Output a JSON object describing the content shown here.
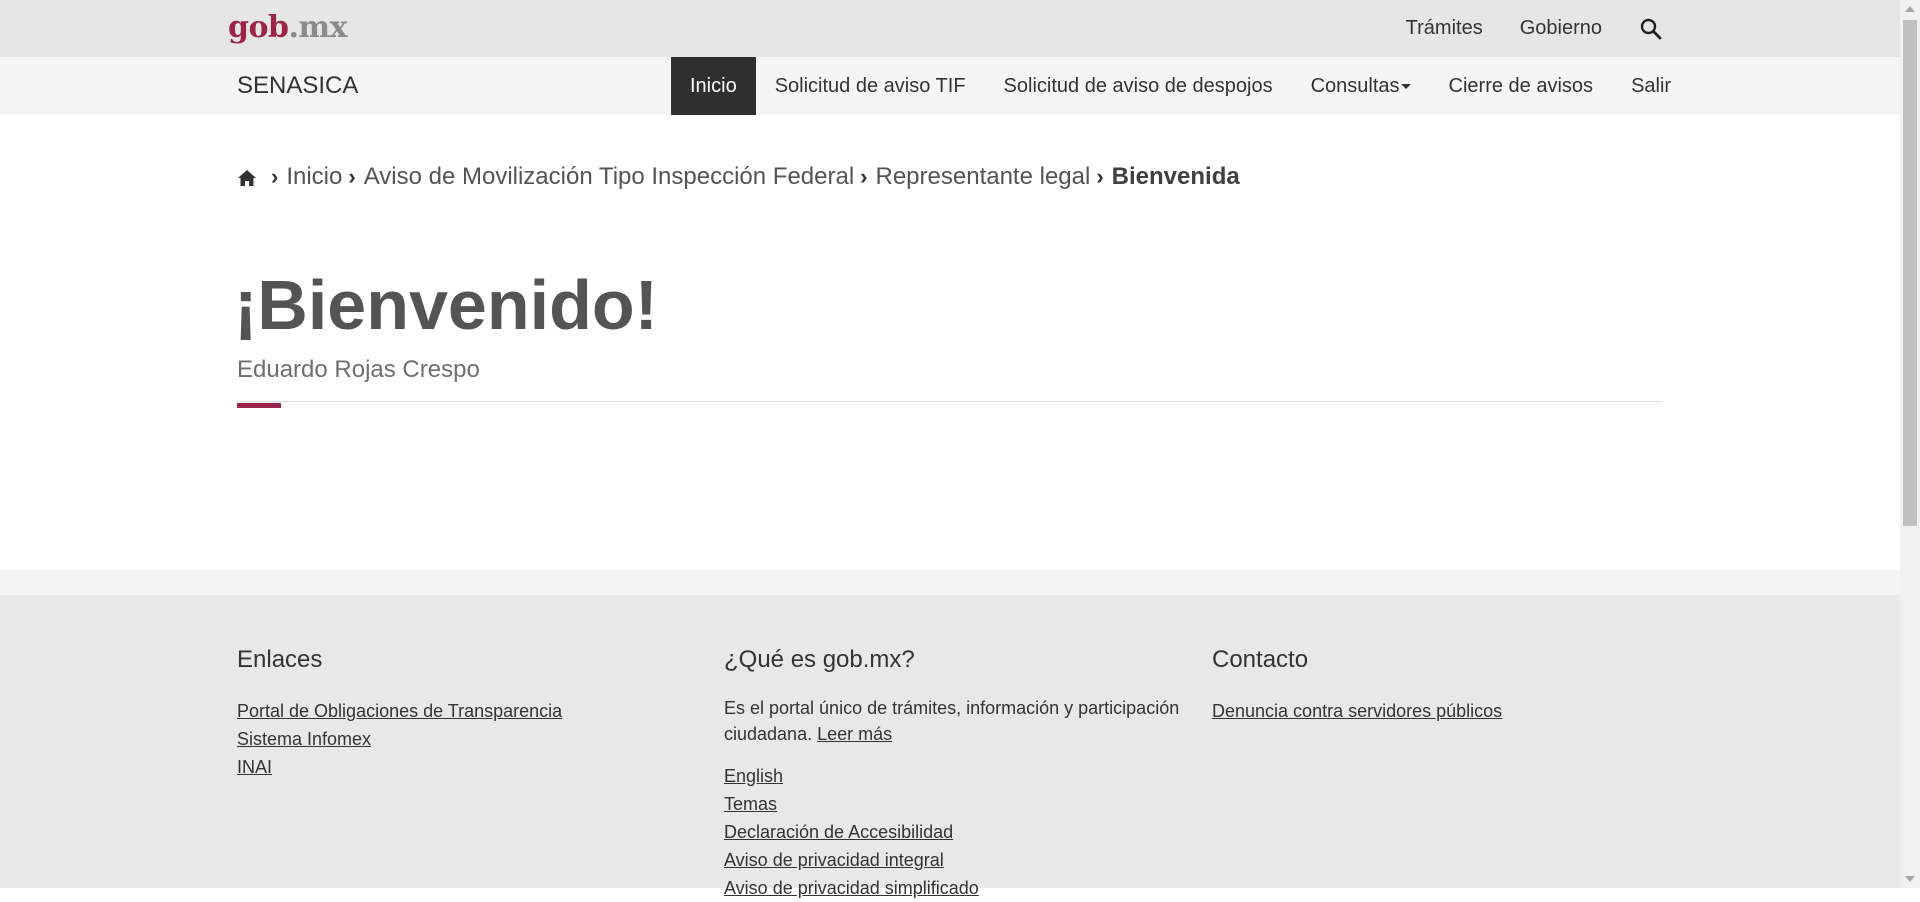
{
  "gov_header": {
    "logo_gob": "gob",
    "logo_mx": ".mx",
    "links": [
      "Trámites",
      "Gobierno"
    ],
    "search_icon": "search-icon"
  },
  "app_header": {
    "brand": "SENASICA",
    "nav": [
      {
        "label": "Inicio",
        "active": true
      },
      {
        "label": "Solicitud de aviso TIF"
      },
      {
        "label": "Solicitud de aviso de despojos"
      },
      {
        "label": "Consultas",
        "dropdown": true
      },
      {
        "label": "Cierre de avisos"
      },
      {
        "label": "Salir"
      }
    ]
  },
  "breadcrumb": {
    "home_icon": "home-icon",
    "items": [
      "Inicio",
      "Aviso de Movilización Tipo Inspección Federal",
      "Representante legal"
    ],
    "current": "Bienvenida"
  },
  "main": {
    "title": "¡Bienvenido!",
    "user_name": "Eduardo Rojas Crespo"
  },
  "footer": {
    "enlaces": {
      "title": "Enlaces",
      "links": [
        "Portal de Obligaciones de Transparencia",
        "Sistema Infomex",
        "INAI"
      ]
    },
    "que_es": {
      "title": "¿Qué es gob.mx?",
      "description": "Es el portal único de trámites, información y participación ciudadana.",
      "read_more": "Leer más",
      "links": [
        "English",
        "Temas",
        "Declaración de Accesibilidad",
        "Aviso de privacidad integral",
        "Aviso de privacidad simplificado"
      ]
    },
    "contacto": {
      "title": "Contacto",
      "links": [
        "Denuncia contra servidores públicos"
      ]
    }
  },
  "colors": {
    "brand": "#9d2449",
    "nav_active_bg": "#2f2f2f",
    "gov_bar_bg": "#e6e6e6",
    "footer_bg": "#e8e8e8"
  }
}
